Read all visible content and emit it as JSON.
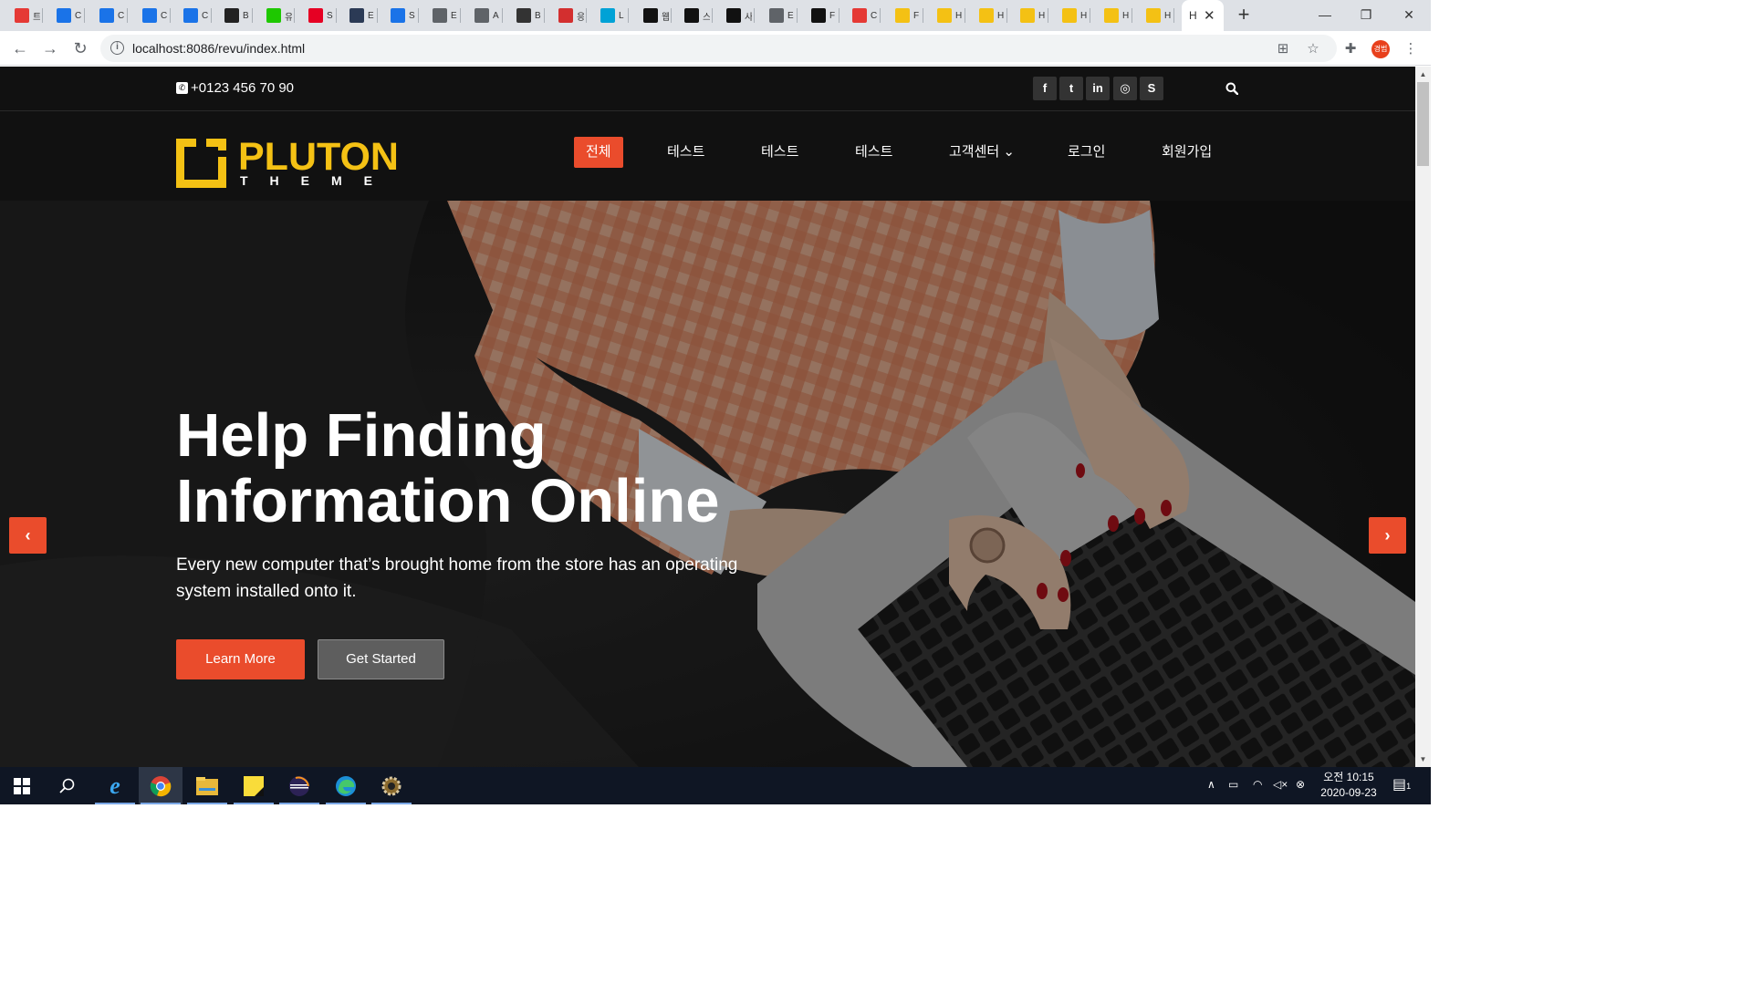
{
  "browser": {
    "tabs": [
      {
        "label": "트",
        "icon": "red-square-icon",
        "color": "#e53935"
      },
      {
        "label": "C",
        "icon": "blue-flag-icon",
        "color": "#1a73e8"
      },
      {
        "label": "C",
        "icon": "blue-flag-icon",
        "color": "#1a73e8"
      },
      {
        "label": "C",
        "icon": "blue-flag-icon",
        "color": "#1a73e8"
      },
      {
        "label": "C",
        "icon": "blue-flag-icon",
        "color": "#1a73e8"
      },
      {
        "label": "B",
        "icon": "notion-icon",
        "color": "#222222"
      },
      {
        "label": "유",
        "icon": "n-green-icon",
        "color": "#1ec800"
      },
      {
        "label": "S",
        "icon": "pinterest-icon",
        "color": "#e60023"
      },
      {
        "label": "E",
        "icon": "b-dark-icon",
        "color": "#2b3a55"
      },
      {
        "label": "S",
        "icon": "blue-doc-icon",
        "color": "#1a73e8"
      },
      {
        "label": "E",
        "icon": "globe-icon",
        "color": "#5f6368"
      },
      {
        "label": "A",
        "icon": "globe-icon",
        "color": "#5f6368"
      },
      {
        "label": "B",
        "icon": "w-icon",
        "color": "#333333"
      },
      {
        "label": "응",
        "icon": "red-book-icon",
        "color": "#d32f2f"
      },
      {
        "label": "L",
        "icon": "px-icon",
        "color": "#00a2d6"
      },
      {
        "label": "웹",
        "icon": "wix-icon",
        "color": "#111111"
      },
      {
        "label": "스",
        "icon": "wix-icon",
        "color": "#111111"
      },
      {
        "label": "사",
        "icon": "wix-icon",
        "color": "#111111"
      },
      {
        "label": "E",
        "icon": "globe-icon",
        "color": "#5f6368"
      },
      {
        "label": "F",
        "icon": "bowtie-icon",
        "color": "#111111"
      },
      {
        "label": "C",
        "icon": "s-red-icon",
        "color": "#e53935"
      },
      {
        "label": "F",
        "icon": "pluton-icon",
        "color": "#f4c114"
      },
      {
        "label": "H",
        "icon": "pluton-icon",
        "color": "#f4c114"
      },
      {
        "label": "H",
        "icon": "pluton-icon",
        "color": "#f4c114"
      },
      {
        "label": "H",
        "icon": "pluton-icon",
        "color": "#f4c114"
      },
      {
        "label": "H",
        "icon": "pluton-icon",
        "color": "#f4c114"
      },
      {
        "label": "H",
        "icon": "pluton-icon",
        "color": "#f4c114"
      },
      {
        "label": "H",
        "icon": "pluton-icon",
        "color": "#f4c114"
      }
    ],
    "active_tab": {
      "label": "H"
    },
    "url": "localhost:8086/revu/index.html",
    "profile_initials": "경범"
  },
  "site": {
    "phone": "+0123 456 70 90",
    "social": [
      {
        "icon": "facebook-icon",
        "glyph": "f"
      },
      {
        "icon": "twitter-icon",
        "glyph": "t"
      },
      {
        "icon": "linkedin-icon",
        "glyph": "in"
      },
      {
        "icon": "dribbble-icon",
        "glyph": "◎"
      },
      {
        "icon": "skype-icon",
        "glyph": "S"
      }
    ],
    "logo": {
      "brand": "PLUTON",
      "sub": "THEME"
    },
    "menu": [
      "전체",
      "테스트",
      "테스트",
      "테스트",
      "고객센터 ⌄",
      "로그인",
      "회원가입"
    ],
    "accent": "#ea4c2c",
    "brand_color": "#f4c114"
  },
  "hero": {
    "title_line1": "Help Finding",
    "title_line2": "Information Online",
    "text": "Every new computer that’s brought home from the store has an operating system installed onto it.",
    "learn_more": "Learn More",
    "get_started": "Get Started",
    "prev": "‹",
    "next": "›"
  },
  "taskbar": {
    "apps": [
      "start-icon",
      "search-icon",
      "ie-icon",
      "chrome-icon",
      "explorer-icon",
      "sticky-notes-icon",
      "eclipse-icon",
      "edge-icon",
      "settings-app-icon"
    ],
    "time": "오전 10:15",
    "date": "2020-09-23",
    "notifications": "1"
  }
}
